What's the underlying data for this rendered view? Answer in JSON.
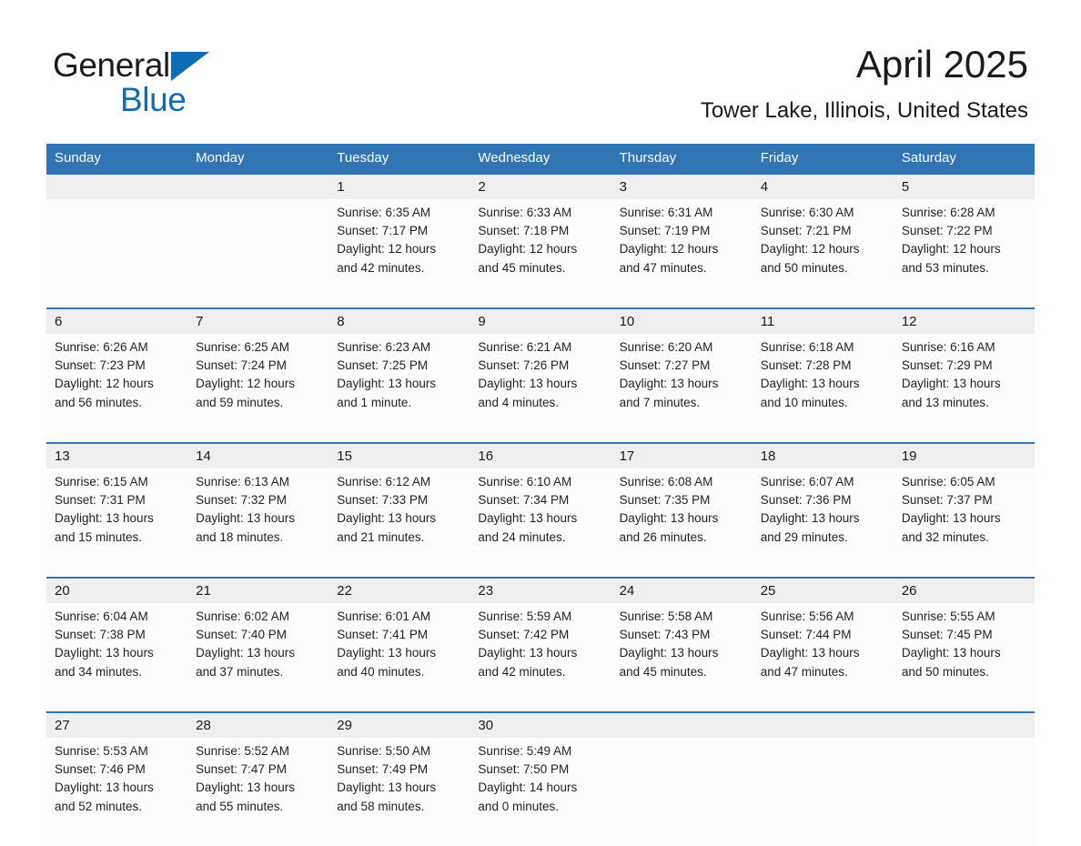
{
  "logo": {
    "text_top": "General",
    "text_bottom": "Blue",
    "triangle_color": "#0f6cb4",
    "top_color": "#1c1c1c"
  },
  "header": {
    "month_title": "April 2025",
    "location": "Tower Lake, Illinois, United States"
  },
  "theme": {
    "header_blue": "#3275b5",
    "daynum_bg": "#efefef",
    "cell_bg": "#fdfdfd"
  },
  "calendar": {
    "weekday_headers": [
      "Sunday",
      "Monday",
      "Tuesday",
      "Wednesday",
      "Thursday",
      "Friday",
      "Saturday"
    ],
    "weeks": [
      [
        {
          "day": "",
          "lines": []
        },
        {
          "day": "",
          "lines": []
        },
        {
          "day": "1",
          "lines": [
            "Sunrise: 6:35 AM",
            "Sunset: 7:17 PM",
            "Daylight: 12 hours",
            "and 42 minutes."
          ]
        },
        {
          "day": "2",
          "lines": [
            "Sunrise: 6:33 AM",
            "Sunset: 7:18 PM",
            "Daylight: 12 hours",
            "and 45 minutes."
          ]
        },
        {
          "day": "3",
          "lines": [
            "Sunrise: 6:31 AM",
            "Sunset: 7:19 PM",
            "Daylight: 12 hours",
            "and 47 minutes."
          ]
        },
        {
          "day": "4",
          "lines": [
            "Sunrise: 6:30 AM",
            "Sunset: 7:21 PM",
            "Daylight: 12 hours",
            "and 50 minutes."
          ]
        },
        {
          "day": "5",
          "lines": [
            "Sunrise: 6:28 AM",
            "Sunset: 7:22 PM",
            "Daylight: 12 hours",
            "and 53 minutes."
          ]
        }
      ],
      [
        {
          "day": "6",
          "lines": [
            "Sunrise: 6:26 AM",
            "Sunset: 7:23 PM",
            "Daylight: 12 hours",
            "and 56 minutes."
          ]
        },
        {
          "day": "7",
          "lines": [
            "Sunrise: 6:25 AM",
            "Sunset: 7:24 PM",
            "Daylight: 12 hours",
            "and 59 minutes."
          ]
        },
        {
          "day": "8",
          "lines": [
            "Sunrise: 6:23 AM",
            "Sunset: 7:25 PM",
            "Daylight: 13 hours",
            "and 1 minute."
          ]
        },
        {
          "day": "9",
          "lines": [
            "Sunrise: 6:21 AM",
            "Sunset: 7:26 PM",
            "Daylight: 13 hours",
            "and 4 minutes."
          ]
        },
        {
          "day": "10",
          "lines": [
            "Sunrise: 6:20 AM",
            "Sunset: 7:27 PM",
            "Daylight: 13 hours",
            "and 7 minutes."
          ]
        },
        {
          "day": "11",
          "lines": [
            "Sunrise: 6:18 AM",
            "Sunset: 7:28 PM",
            "Daylight: 13 hours",
            "and 10 minutes."
          ]
        },
        {
          "day": "12",
          "lines": [
            "Sunrise: 6:16 AM",
            "Sunset: 7:29 PM",
            "Daylight: 13 hours",
            "and 13 minutes."
          ]
        }
      ],
      [
        {
          "day": "13",
          "lines": [
            "Sunrise: 6:15 AM",
            "Sunset: 7:31 PM",
            "Daylight: 13 hours",
            "and 15 minutes."
          ]
        },
        {
          "day": "14",
          "lines": [
            "Sunrise: 6:13 AM",
            "Sunset: 7:32 PM",
            "Daylight: 13 hours",
            "and 18 minutes."
          ]
        },
        {
          "day": "15",
          "lines": [
            "Sunrise: 6:12 AM",
            "Sunset: 7:33 PM",
            "Daylight: 13 hours",
            "and 21 minutes."
          ]
        },
        {
          "day": "16",
          "lines": [
            "Sunrise: 6:10 AM",
            "Sunset: 7:34 PM",
            "Daylight: 13 hours",
            "and 24 minutes."
          ]
        },
        {
          "day": "17",
          "lines": [
            "Sunrise: 6:08 AM",
            "Sunset: 7:35 PM",
            "Daylight: 13 hours",
            "and 26 minutes."
          ]
        },
        {
          "day": "18",
          "lines": [
            "Sunrise: 6:07 AM",
            "Sunset: 7:36 PM",
            "Daylight: 13 hours",
            "and 29 minutes."
          ]
        },
        {
          "day": "19",
          "lines": [
            "Sunrise: 6:05 AM",
            "Sunset: 7:37 PM",
            "Daylight: 13 hours",
            "and 32 minutes."
          ]
        }
      ],
      [
        {
          "day": "20",
          "lines": [
            "Sunrise: 6:04 AM",
            "Sunset: 7:38 PM",
            "Daylight: 13 hours",
            "and 34 minutes."
          ]
        },
        {
          "day": "21",
          "lines": [
            "Sunrise: 6:02 AM",
            "Sunset: 7:40 PM",
            "Daylight: 13 hours",
            "and 37 minutes."
          ]
        },
        {
          "day": "22",
          "lines": [
            "Sunrise: 6:01 AM",
            "Sunset: 7:41 PM",
            "Daylight: 13 hours",
            "and 40 minutes."
          ]
        },
        {
          "day": "23",
          "lines": [
            "Sunrise: 5:59 AM",
            "Sunset: 7:42 PM",
            "Daylight: 13 hours",
            "and 42 minutes."
          ]
        },
        {
          "day": "24",
          "lines": [
            "Sunrise: 5:58 AM",
            "Sunset: 7:43 PM",
            "Daylight: 13 hours",
            "and 45 minutes."
          ]
        },
        {
          "day": "25",
          "lines": [
            "Sunrise: 5:56 AM",
            "Sunset: 7:44 PM",
            "Daylight: 13 hours",
            "and 47 minutes."
          ]
        },
        {
          "day": "26",
          "lines": [
            "Sunrise: 5:55 AM",
            "Sunset: 7:45 PM",
            "Daylight: 13 hours",
            "and 50 minutes."
          ]
        }
      ],
      [
        {
          "day": "27",
          "lines": [
            "Sunrise: 5:53 AM",
            "Sunset: 7:46 PM",
            "Daylight: 13 hours",
            "and 52 minutes."
          ]
        },
        {
          "day": "28",
          "lines": [
            "Sunrise: 5:52 AM",
            "Sunset: 7:47 PM",
            "Daylight: 13 hours",
            "and 55 minutes."
          ]
        },
        {
          "day": "29",
          "lines": [
            "Sunrise: 5:50 AM",
            "Sunset: 7:49 PM",
            "Daylight: 13 hours",
            "and 58 minutes."
          ]
        },
        {
          "day": "30",
          "lines": [
            "Sunrise: 5:49 AM",
            "Sunset: 7:50 PM",
            "Daylight: 14 hours",
            "and 0 minutes."
          ]
        },
        {
          "day": "",
          "lines": []
        },
        {
          "day": "",
          "lines": []
        },
        {
          "day": "",
          "lines": []
        }
      ]
    ]
  }
}
